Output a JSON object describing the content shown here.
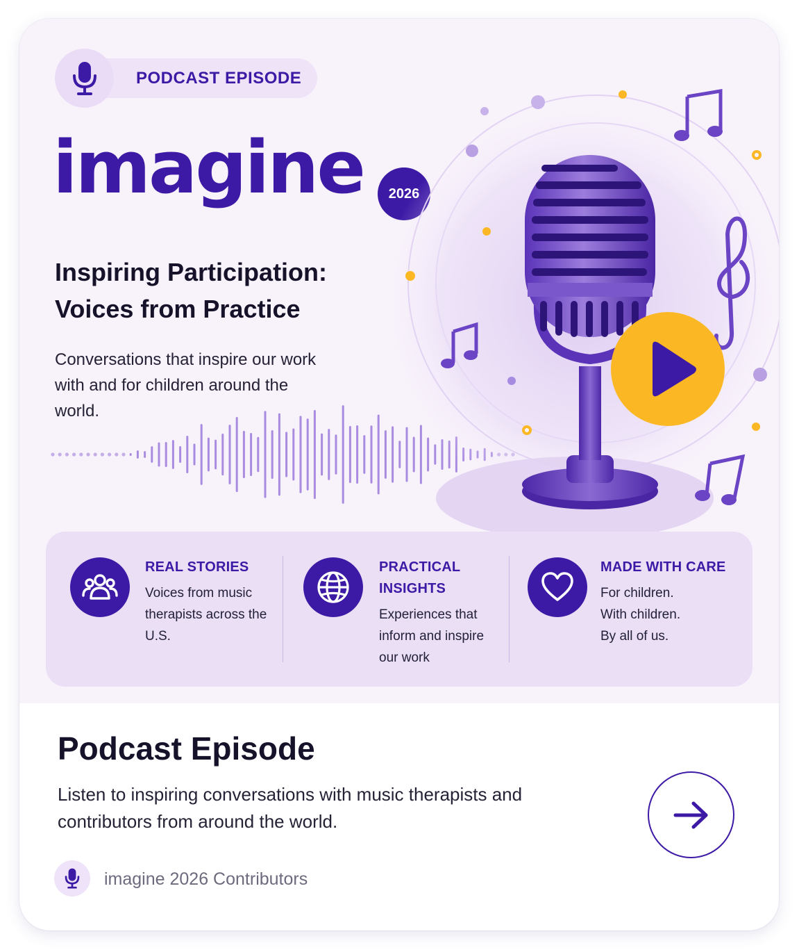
{
  "badge": {
    "label": "PODCAST EPISODE",
    "icon": "microphone-icon"
  },
  "brand": {
    "name": "imagine",
    "year": "2026"
  },
  "hero": {
    "title": "Inspiring Participation: Voices from Practice",
    "subtitle": "Conversations that inspire our work with and for children around the world.",
    "play_icon": "play-icon"
  },
  "features": [
    {
      "icon": "people-icon",
      "title": "REAL STORIES",
      "description": "Voices from music therapists across the U.S."
    },
    {
      "icon": "globe-icon",
      "title": "PRACTICAL INSIGHTS",
      "description": "Experiences that inform and inspire our work"
    },
    {
      "icon": "heart-icon",
      "title": "MADE WITH CARE",
      "description": "For children. With children. By all of us."
    }
  ],
  "episode": {
    "title": "Podcast Episode",
    "description": "Listen to inspiring conversations with music therapists and contributors from around the world.",
    "action_icon": "arrow-right-icon"
  },
  "author": {
    "name": "imagine 2026 Contributors",
    "icon": "microphone-icon"
  },
  "colors": {
    "primary": "#3d1aa6",
    "accent": "#fbb724",
    "hero_bg": "#f8f2fb",
    "feature_bg": "#ebdff6"
  }
}
